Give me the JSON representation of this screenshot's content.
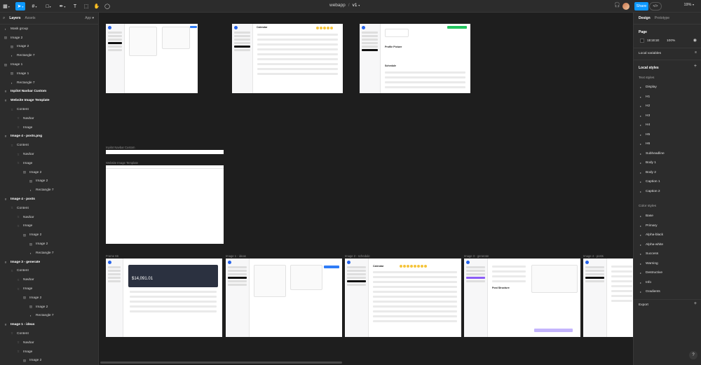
{
  "app": {
    "file_name": "webapp",
    "version": "v1",
    "share_label": "Share",
    "code_label": "</>",
    "zoom": "19%"
  },
  "left_panel": {
    "tabs": [
      "Layers",
      "Assets"
    ],
    "page_selector": "App",
    "layers": [
      {
        "label": "Mask group",
        "indent": 0,
        "icon": "mask",
        "bold": false
      },
      {
        "label": "Image 2",
        "indent": 0,
        "icon": "image",
        "bold": false
      },
      {
        "label": "Image 2",
        "indent": 1,
        "icon": "image",
        "bold": false
      },
      {
        "label": "Rectangle 7",
        "indent": 1,
        "icon": "mask",
        "bold": false
      },
      {
        "label": "Image 1",
        "indent": 0,
        "icon": "image",
        "bold": false
      },
      {
        "label": "Image 1",
        "indent": 1,
        "icon": "image",
        "bold": false
      },
      {
        "label": "Rectangle 7",
        "indent": 1,
        "icon": "mask",
        "bold": false
      },
      {
        "label": "Inpilot Navbar Custom",
        "indent": 0,
        "icon": "frame",
        "bold": true
      },
      {
        "label": "Website Image Template",
        "indent": 0,
        "icon": "frame",
        "bold": true
      },
      {
        "label": "Content",
        "indent": 1,
        "icon": "grid",
        "bold": false
      },
      {
        "label": "Navbar",
        "indent": 2,
        "icon": "grid",
        "bold": false
      },
      {
        "label": "Image",
        "indent": 2,
        "icon": "grid",
        "bold": false
      },
      {
        "label": "Image 4 - posts.png",
        "indent": 0,
        "icon": "frame",
        "bold": true
      },
      {
        "label": "Content",
        "indent": 1,
        "icon": "grid",
        "bold": false
      },
      {
        "label": "Navbar",
        "indent": 2,
        "icon": "grid",
        "bold": false
      },
      {
        "label": "Image",
        "indent": 2,
        "icon": "grid",
        "bold": false
      },
      {
        "label": "Image 2",
        "indent": 3,
        "icon": "image",
        "bold": false
      },
      {
        "label": "Image 2",
        "indent": 4,
        "icon": "image",
        "bold": false
      },
      {
        "label": "Rectangle 7",
        "indent": 4,
        "icon": "mask",
        "bold": false
      },
      {
        "label": "Image 4 - posts",
        "indent": 0,
        "icon": "frame",
        "bold": true
      },
      {
        "label": "Content",
        "indent": 1,
        "icon": "grid",
        "bold": false
      },
      {
        "label": "Navbar",
        "indent": 2,
        "icon": "grid",
        "bold": false
      },
      {
        "label": "Image",
        "indent": 2,
        "icon": "grid",
        "bold": false
      },
      {
        "label": "Image 2",
        "indent": 3,
        "icon": "image",
        "bold": false
      },
      {
        "label": "Image 2",
        "indent": 4,
        "icon": "image",
        "bold": false
      },
      {
        "label": "Rectangle 7",
        "indent": 4,
        "icon": "mask",
        "bold": false
      },
      {
        "label": "Image 3 - generate",
        "indent": 0,
        "icon": "frame",
        "bold": true
      },
      {
        "label": "Content",
        "indent": 1,
        "icon": "grid",
        "bold": false
      },
      {
        "label": "Navbar",
        "indent": 2,
        "icon": "grid",
        "bold": false
      },
      {
        "label": "Image",
        "indent": 2,
        "icon": "grid",
        "bold": false
      },
      {
        "label": "Image 2",
        "indent": 3,
        "icon": "image",
        "bold": false
      },
      {
        "label": "Image 2",
        "indent": 4,
        "icon": "image",
        "bold": false
      },
      {
        "label": "Rectangle 7",
        "indent": 4,
        "icon": "mask",
        "bold": false
      },
      {
        "label": "Image 1 - ideas",
        "indent": 0,
        "icon": "frame",
        "bold": true
      },
      {
        "label": "Content",
        "indent": 1,
        "icon": "grid",
        "bold": false
      },
      {
        "label": "Navbar",
        "indent": 2,
        "icon": "grid",
        "bold": false
      },
      {
        "label": "Image",
        "indent": 2,
        "icon": "grid",
        "bold": false
      },
      {
        "label": "Image 2",
        "indent": 3,
        "icon": "image",
        "bold": false
      }
    ]
  },
  "canvas": {
    "frame_labels": {
      "navbar_custom": "Inpilot Navbar Custom",
      "website_template": "Website Image Template",
      "frame66": "Frame 66",
      "ideas": "Image 1 - ideas",
      "schedule": "Image 2 - schedule",
      "generate": "Image 3 - generate",
      "posts": "Image 4 - posts"
    },
    "balance": "$14,091.01",
    "calendar_title": "Calendar",
    "profile_picture": "Profile Picture",
    "schedule_title": "Schedule",
    "post_structure": "Post Structure"
  },
  "right_panel": {
    "tabs": [
      "Design",
      "Prototype"
    ],
    "page_label": "Page",
    "page_color": "1E1E1E",
    "page_opacity": "100%",
    "local_variables": "Local variables",
    "local_styles": "Local styles",
    "text_styles_label": "Text styles",
    "text_styles": [
      "Display",
      "H1",
      "H2",
      "H3",
      "H4",
      "H5",
      "H6",
      "Subheadline",
      "Body 1",
      "Body 2",
      "Caption 1",
      "Caption 2"
    ],
    "color_styles_label": "Color styles",
    "color_styles": [
      "Base",
      "Primary",
      "Alpha-black",
      "Alpha-white",
      "Success",
      "Warning",
      "Destructive",
      "Info",
      "Gradients"
    ],
    "export_label": "Export"
  }
}
